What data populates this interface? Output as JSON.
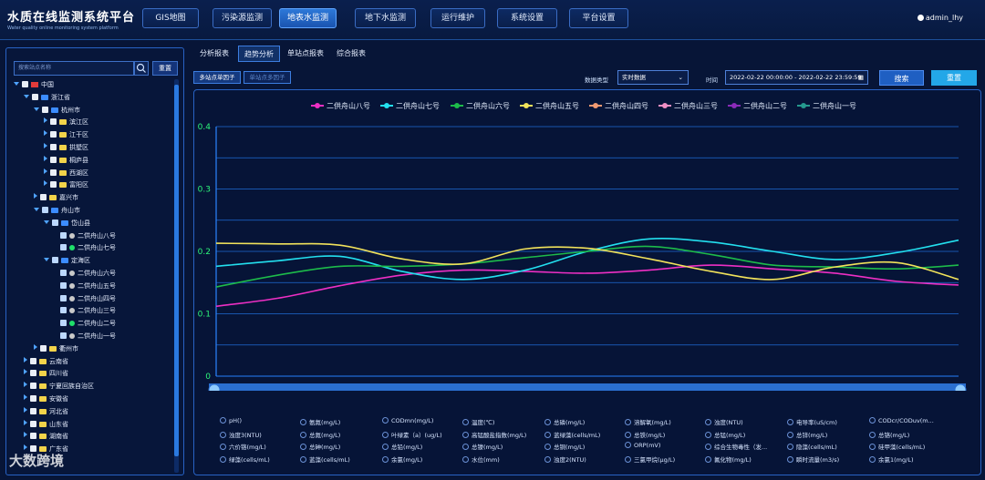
{
  "app": {
    "title": "水质在线监测系统平台",
    "subtitle": "Water quality online monitoring system platform",
    "user": "admin_lhy"
  },
  "nav": [
    "GIS地图",
    "污染源监测",
    "地表水监测",
    "地下水监测",
    "运行维护",
    "系统设置",
    "平台设置"
  ],
  "nav_active": 2,
  "sidebar": {
    "search_placeholder": "搜索站点名称",
    "reset_label": "重置"
  },
  "tree": [
    {
      "label": "中国",
      "depth": 0,
      "arrow": "down",
      "cb": false,
      "ico": "flag"
    },
    {
      "label": "浙江省",
      "depth": 1,
      "arrow": "down",
      "cb": false,
      "ico": "fold-b"
    },
    {
      "label": "杭州市",
      "depth": 2,
      "arrow": "down",
      "cb": false,
      "ico": "fold-b"
    },
    {
      "label": "滨江区",
      "depth": 3,
      "arrow": "right",
      "cb": false,
      "ico": "fold-y"
    },
    {
      "label": "江干区",
      "depth": 3,
      "arrow": "right",
      "cb": false,
      "ico": "fold-y"
    },
    {
      "label": "拱墅区",
      "depth": 3,
      "arrow": "right",
      "cb": false,
      "ico": "fold-y"
    },
    {
      "label": "桐庐县",
      "depth": 3,
      "arrow": "right",
      "cb": false,
      "ico": "fold-y"
    },
    {
      "label": "西湖区",
      "depth": 3,
      "arrow": "right",
      "cb": false,
      "ico": "fold-y"
    },
    {
      "label": "富阳区",
      "depth": 3,
      "arrow": "right",
      "cb": false,
      "ico": "fold-y"
    },
    {
      "label": "嘉兴市",
      "depth": 2,
      "arrow": "right",
      "cb": false,
      "ico": "fold-y"
    },
    {
      "label": "舟山市",
      "depth": 2,
      "arrow": "down",
      "cb": true,
      "ico": "fold-b"
    },
    {
      "label": "岱山县",
      "depth": 3,
      "arrow": "down",
      "cb": true,
      "ico": "fold-b"
    },
    {
      "label": "二供舟山八号",
      "depth": 4,
      "arrow": "",
      "cb": true,
      "ico": "pin"
    },
    {
      "label": "二供舟山七号",
      "depth": 4,
      "arrow": "",
      "cb": true,
      "ico": "pin-g"
    },
    {
      "label": "定海区",
      "depth": 3,
      "arrow": "down",
      "cb": true,
      "ico": "fold-b"
    },
    {
      "label": "二供舟山六号",
      "depth": 4,
      "arrow": "",
      "cb": true,
      "ico": "pin"
    },
    {
      "label": "二供舟山五号",
      "depth": 4,
      "arrow": "",
      "cb": true,
      "ico": "pin"
    },
    {
      "label": "二供舟山四号",
      "depth": 4,
      "arrow": "",
      "cb": true,
      "ico": "pin"
    },
    {
      "label": "二供舟山三号",
      "depth": 4,
      "arrow": "",
      "cb": true,
      "ico": "pin"
    },
    {
      "label": "二供舟山二号",
      "depth": 4,
      "arrow": "",
      "cb": true,
      "ico": "pin-g"
    },
    {
      "label": "二供舟山一号",
      "depth": 4,
      "arrow": "",
      "cb": true,
      "ico": "pin"
    },
    {
      "label": "衢州市",
      "depth": 2,
      "arrow": "right",
      "cb": false,
      "ico": "fold-y"
    },
    {
      "label": "云南省",
      "depth": 1,
      "arrow": "right",
      "cb": false,
      "ico": "fold-y"
    },
    {
      "label": "四川省",
      "depth": 1,
      "arrow": "right",
      "cb": false,
      "ico": "fold-y"
    },
    {
      "label": "宁夏回族自治区",
      "depth": 1,
      "arrow": "right",
      "cb": false,
      "ico": "fold-y"
    },
    {
      "label": "安徽省",
      "depth": 1,
      "arrow": "right",
      "cb": false,
      "ico": "fold-y"
    },
    {
      "label": "河北省",
      "depth": 1,
      "arrow": "right",
      "cb": false,
      "ico": "fold-y"
    },
    {
      "label": "山东省",
      "depth": 1,
      "arrow": "right",
      "cb": false,
      "ico": "fold-y"
    },
    {
      "label": "湖南省",
      "depth": 1,
      "arrow": "right",
      "cb": false,
      "ico": "fold-y"
    },
    {
      "label": "广东省",
      "depth": 1,
      "arrow": "right",
      "cb": false,
      "ico": "fold-y"
    }
  ],
  "tabs": [
    "分析报表",
    "趋势分析",
    "单站点报表",
    "综合报表"
  ],
  "tab_active": 1,
  "subtabs": [
    "多站点单因子",
    "单站点多因子"
  ],
  "filters": {
    "type_label": "数据类型",
    "type_value": "实时数据",
    "time_label": "时间",
    "time_value": "2022-02-22 00:00:00 - 2022-02-22 23:59:59",
    "search_label": "搜索",
    "reset_label": "重置"
  },
  "chart_data": {
    "type": "line",
    "ylim": [
      0,
      0.4
    ],
    "yticks": [
      0,
      0.1,
      0.2,
      0.3,
      0.4
    ],
    "ytick_labels": [
      "0",
      "0.1",
      "0.2",
      "0.3",
      "0.4"
    ],
    "x": [
      0,
      1,
      2,
      3,
      4,
      5,
      6,
      7,
      8,
      9,
      10,
      11,
      12
    ],
    "series": [
      {
        "name": "二供舟山八号",
        "color": "#ee2fc4",
        "values": [
          0.112,
          0.125,
          0.145,
          0.162,
          0.17,
          0.168,
          0.165,
          0.17,
          0.178,
          0.172,
          0.165,
          0.152,
          0.146
        ]
      },
      {
        "name": "二供舟山七号",
        "color": "#23e0ef",
        "values": [
          0.176,
          0.185,
          0.192,
          0.168,
          0.155,
          0.17,
          0.2,
          0.22,
          0.215,
          0.2,
          0.187,
          0.198,
          0.218
        ]
      },
      {
        "name": "二供舟山六号",
        "color": "#1dbb4a",
        "values": [
          0.143,
          0.162,
          0.176,
          0.176,
          0.18,
          0.19,
          0.2,
          0.208,
          0.195,
          0.178,
          0.175,
          0.172,
          0.178
        ]
      },
      {
        "name": "二供舟山五号",
        "color": "#f2e35b",
        "values": [
          0.213,
          0.212,
          0.21,
          0.188,
          0.18,
          0.204,
          0.205,
          0.188,
          0.168,
          0.155,
          0.175,
          0.182,
          0.155
        ]
      },
      {
        "name": "二供舟山四号",
        "color": "#f29a72",
        "values": []
      },
      {
        "name": "二供舟山三号",
        "color": "#f08fc4",
        "values": []
      },
      {
        "name": "二供舟山二号",
        "color": "#8a2bb8",
        "values": []
      },
      {
        "name": "二供舟山一号",
        "color": "#25998e",
        "values": []
      }
    ]
  },
  "params": [
    "pH()",
    "氨氮(mg/L)",
    "CODmn(mg/L)",
    "温度(℃)",
    "总磷(mg/L)",
    "溶解氧(mg/L)",
    "浊度(NTU)",
    "电导率(uS/cm)",
    "CODcr/CODuv(m...",
    "浊度3(NTU)",
    "总氮(mg/L)",
    "叶绿素（a）(ug/L)",
    "高锰酸盐指数(mg/L)",
    "蓝绿藻(cells/mL)",
    "总铁(mg/L)",
    "总锰(mg/L)",
    "总锌(mg/L)",
    "总铬(mg/L)",
    "六价铬(mg/L)",
    "总砷(mg/L)",
    "总铅(mg/L)",
    "总镍(mg/L)",
    "总铜(mg/L)",
    "ORP(mV)",
    "综合生物毒性（发...",
    "隐藻(cells/mL)",
    "硅甲藻(cells/mL)",
    "绿藻(cells/mL)",
    "蓝藻(cells/mL)",
    "余氯(mg/L)",
    "水位(mm)",
    "浊度2(NTU)",
    "三氯甲烷(μg/L)",
    "氟化物(mg/L)",
    "瞬时流量(m3/s)",
    "余氯1(mg/L)"
  ],
  "watermark": "大数跨境"
}
